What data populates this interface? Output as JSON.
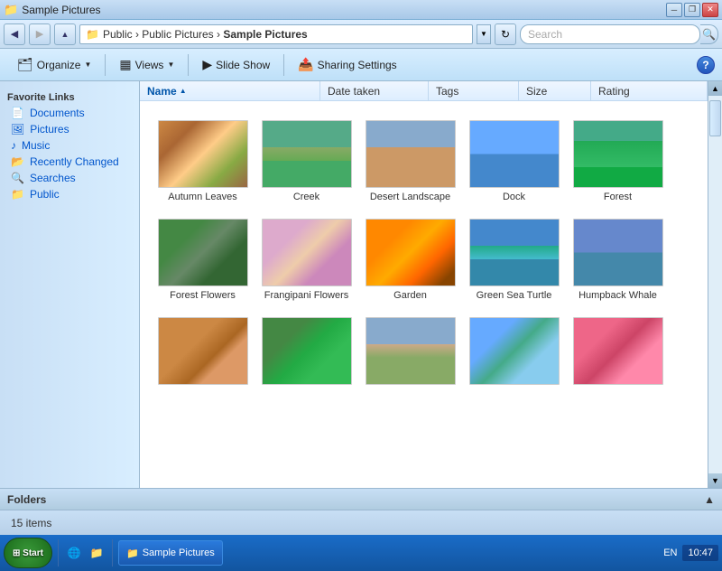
{
  "window": {
    "title": "Sample Pictures",
    "controls": {
      "minimize": "─",
      "restore": "❐",
      "close": "✕"
    }
  },
  "address_bar": {
    "back_tooltip": "Back",
    "forward_tooltip": "Forward",
    "path": "Public > Public Pictures > Sample Pictures",
    "path_parts": [
      "Public",
      "Public Pictures",
      "Sample Pictures"
    ],
    "refresh_icon": "↻",
    "search_placeholder": "Search"
  },
  "toolbar": {
    "organize_label": "Organize",
    "views_label": "Views",
    "slideshow_label": "Slide Show",
    "sharing_label": "Sharing Settings",
    "help_label": "?"
  },
  "sidebar": {
    "section_title": "Favorite Links",
    "items": [
      {
        "id": "documents",
        "label": "Documents",
        "icon": "📄"
      },
      {
        "id": "pictures",
        "label": "Pictures",
        "icon": "🖼"
      },
      {
        "id": "music",
        "label": "Music",
        "icon": "♪"
      },
      {
        "id": "recently-changed",
        "label": "Recently Changed",
        "icon": "📂"
      },
      {
        "id": "searches",
        "label": "Searches",
        "icon": "🔍"
      },
      {
        "id": "public",
        "label": "Public",
        "icon": "📁"
      }
    ]
  },
  "columns": [
    {
      "id": "name",
      "label": "Name",
      "active": true
    },
    {
      "id": "date-taken",
      "label": "Date taken"
    },
    {
      "id": "tags",
      "label": "Tags"
    },
    {
      "id": "size",
      "label": "Size"
    },
    {
      "id": "rating",
      "label": "Rating"
    }
  ],
  "thumbnails": [
    {
      "id": "autumn-leaves",
      "label": "Autumn Leaves",
      "css_class": "thumb-autumn"
    },
    {
      "id": "creek",
      "label": "Creek",
      "css_class": "thumb-creek"
    },
    {
      "id": "desert-landscape",
      "label": "Desert Landscape",
      "css_class": "thumb-desert"
    },
    {
      "id": "dock",
      "label": "Dock",
      "css_class": "thumb-dock"
    },
    {
      "id": "forest",
      "label": "Forest",
      "css_class": "thumb-forest"
    },
    {
      "id": "forest-flowers",
      "label": "Forest Flowers",
      "css_class": "thumb-fflowers"
    },
    {
      "id": "frangipani-flowers",
      "label": "Frangipani Flowers",
      "css_class": "thumb-frngflowers"
    },
    {
      "id": "garden",
      "label": "Garden",
      "css_class": "thumb-garden"
    },
    {
      "id": "green-sea-turtle",
      "label": "Green Sea Turtle",
      "css_class": "thumb-turtle"
    },
    {
      "id": "humpback-whale",
      "label": "Humpback Whale",
      "css_class": "thumb-whale"
    },
    {
      "id": "dunes",
      "label": "",
      "css_class": "thumb-dunes"
    },
    {
      "id": "toucan",
      "label": "",
      "css_class": "thumb-toucan"
    },
    {
      "id": "tree",
      "label": "",
      "css_class": "thumb-tree"
    },
    {
      "id": "stream",
      "label": "",
      "css_class": "thumb-stream"
    },
    {
      "id": "coral",
      "label": "",
      "css_class": "thumb-coral"
    }
  ],
  "status_bar": {
    "item_count": "15 items"
  },
  "folders_bar": {
    "label": "Folders",
    "toggle_icon": "▲"
  },
  "taskbar": {
    "start_label": "Start",
    "items": [
      {
        "id": "explorer",
        "label": "Sample Pictures"
      }
    ],
    "system_tray": {
      "language": "EN",
      "time": "10:47"
    }
  }
}
